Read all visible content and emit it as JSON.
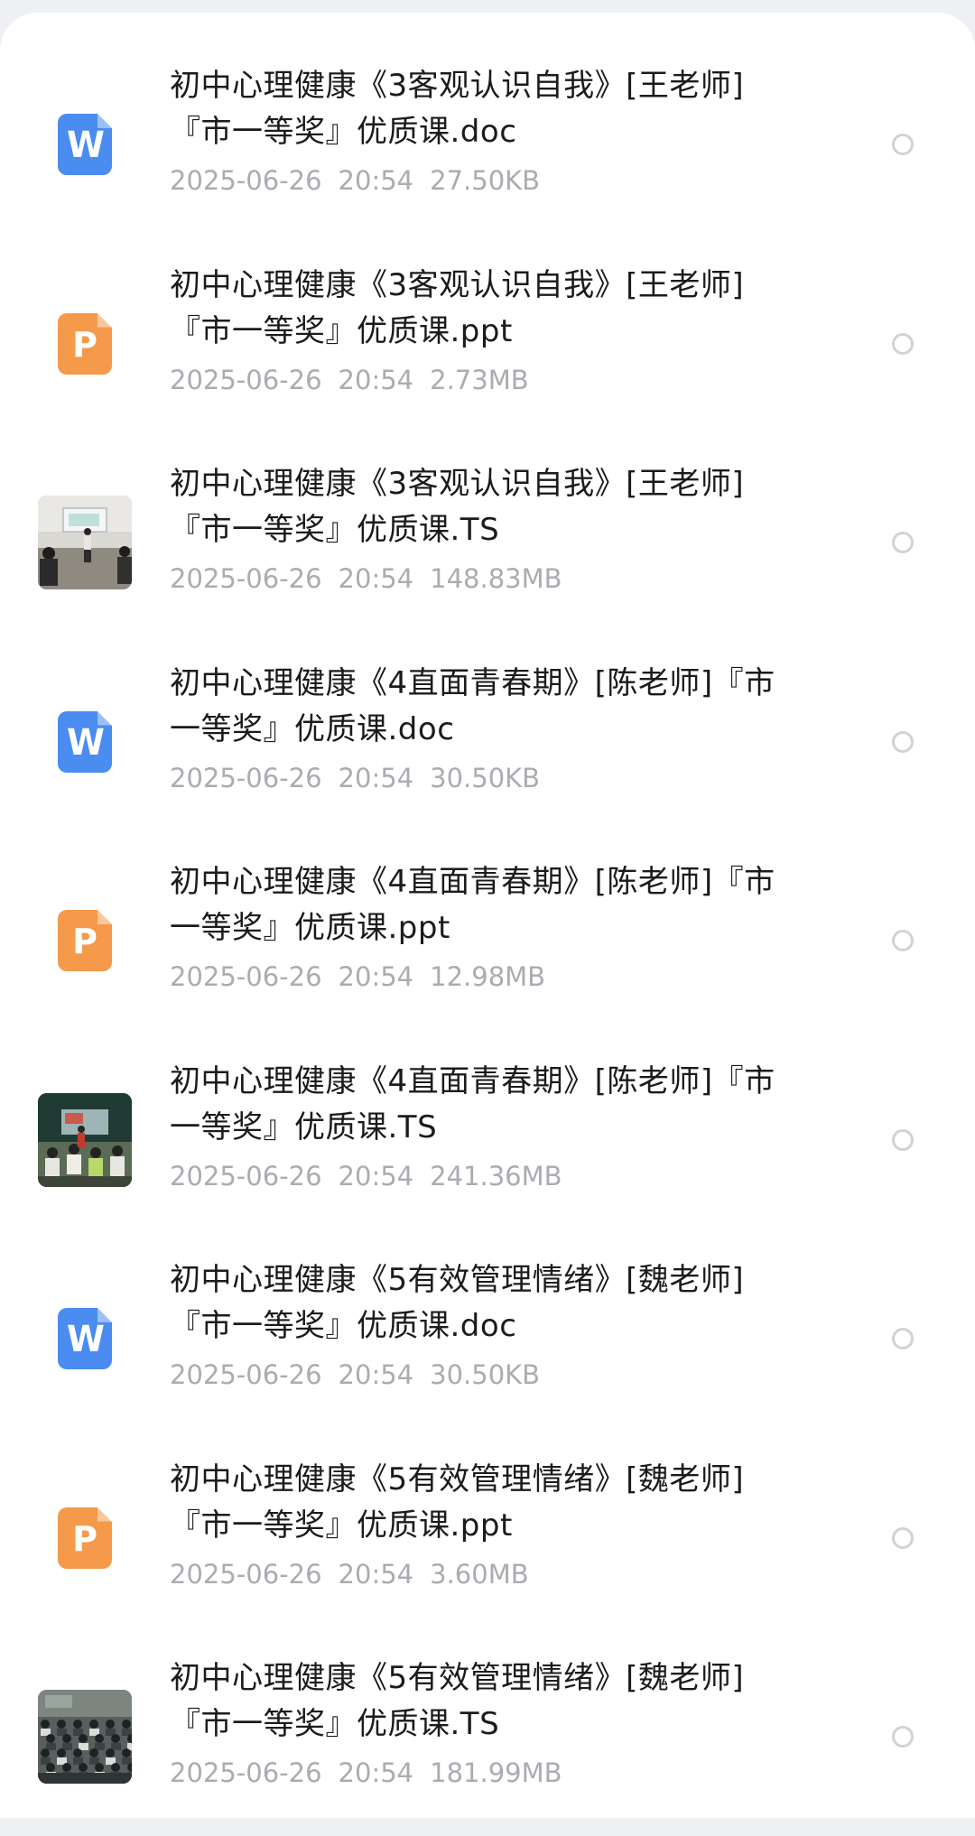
{
  "files": [
    {
      "kind": "doc",
      "icon": "word-doc-icon",
      "glyph": "W",
      "title_lines": [
        "初中心理健康《3客观认识自我》[王老师]",
        "『市一等奖』优质课.doc"
      ],
      "date": "2025-06-26",
      "time": "20:54",
      "size": "27.50KB"
    },
    {
      "kind": "ppt",
      "icon": "powerpoint-icon",
      "glyph": "P",
      "title_lines": [
        "初中心理健康《3客观认识自我》[王老师]",
        "『市一等奖』优质课.ppt"
      ],
      "date": "2025-06-26",
      "time": "20:54",
      "size": "2.73MB"
    },
    {
      "kind": "video",
      "icon": "video-thumbnail",
      "scene": "classroom-teacher-front",
      "title_lines": [
        "初中心理健康《3客观认识自我》[王老师]",
        "『市一等奖』优质课.TS"
      ],
      "date": "2025-06-26",
      "time": "20:54",
      "size": "148.83MB"
    },
    {
      "kind": "doc",
      "icon": "word-doc-icon",
      "glyph": "W",
      "title_lines": [
        "初中心理健康《4直面青春期》[陈老师]『市",
        "一等奖』优质课.doc"
      ],
      "date": "2025-06-26",
      "time": "20:54",
      "size": "30.50KB"
    },
    {
      "kind": "ppt",
      "icon": "powerpoint-icon",
      "glyph": "P",
      "title_lines": [
        "初中心理健康《4直面青春期》[陈老师]『市",
        "一等奖』优质课.ppt"
      ],
      "date": "2025-06-26",
      "time": "20:54",
      "size": "12.98MB"
    },
    {
      "kind": "video",
      "icon": "video-thumbnail",
      "scene": "classroom-students-blackboard",
      "title_lines": [
        "初中心理健康《4直面青春期》[陈老师]『市",
        "一等奖』优质课.TS"
      ],
      "date": "2025-06-26",
      "time": "20:54",
      "size": "241.36MB"
    },
    {
      "kind": "doc",
      "icon": "word-doc-icon",
      "glyph": "W",
      "title_lines": [
        "初中心理健康《5有效管理情绪》[魏老师]",
        "『市一等奖』优质课.doc"
      ],
      "date": "2025-06-26",
      "time": "20:54",
      "size": "30.50KB"
    },
    {
      "kind": "ppt",
      "icon": "powerpoint-icon",
      "glyph": "P",
      "title_lines": [
        "初中心理健康《5有效管理情绪》[魏老师]",
        "『市一等奖』优质课.ppt"
      ],
      "date": "2025-06-26",
      "time": "20:54",
      "size": "3.60MB"
    },
    {
      "kind": "video",
      "icon": "video-thumbnail",
      "scene": "classroom-wide-desks",
      "title_lines": [
        "初中心理健康《5有效管理情绪》[魏老师]",
        "『市一等奖』优质课.TS"
      ],
      "date": "2025-06-26",
      "time": "20:54",
      "size": "181.99MB"
    }
  ],
  "colors": {
    "doc_icon": "#4a8cf0",
    "ppt_icon": "#f49a4a",
    "title_text": "#1b1b1b",
    "meta_text": "#a9acb0",
    "radio_border": "#cfd2d6"
  }
}
